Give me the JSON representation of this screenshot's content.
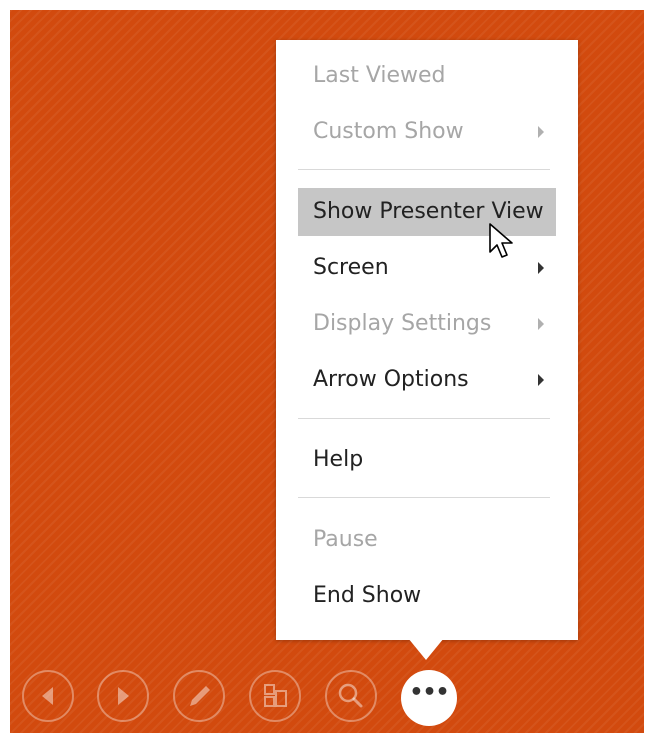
{
  "menu": {
    "items": [
      {
        "label": "Last Viewed",
        "enabled": false,
        "submenu": false
      },
      {
        "label": "Custom Show",
        "enabled": false,
        "submenu": true
      },
      {
        "label": "Show Presenter View",
        "enabled": true,
        "submenu": false,
        "highlighted": true
      },
      {
        "label": "Screen",
        "enabled": true,
        "submenu": true
      },
      {
        "label": "Display Settings",
        "enabled": false,
        "submenu": true
      },
      {
        "label": "Arrow Options",
        "enabled": true,
        "submenu": true
      },
      {
        "label": "Help",
        "enabled": true,
        "submenu": false
      },
      {
        "label": "Pause",
        "enabled": false,
        "submenu": false
      },
      {
        "label": "End Show",
        "enabled": true,
        "submenu": false
      }
    ]
  },
  "toolbar": {
    "buttons": [
      {
        "icon": "previous-icon"
      },
      {
        "icon": "next-icon"
      },
      {
        "icon": "pen-icon"
      },
      {
        "icon": "see-all-slides-icon"
      },
      {
        "icon": "zoom-icon"
      },
      {
        "icon": "more-options-icon",
        "glyph": "•••",
        "active": true
      }
    ]
  },
  "colors": {
    "slide_background": "#d24a0e",
    "menu_background": "#ffffff",
    "highlight": "#c6c6c6",
    "enabled_text": "#222222",
    "disabled_text": "#a6a6a6"
  }
}
